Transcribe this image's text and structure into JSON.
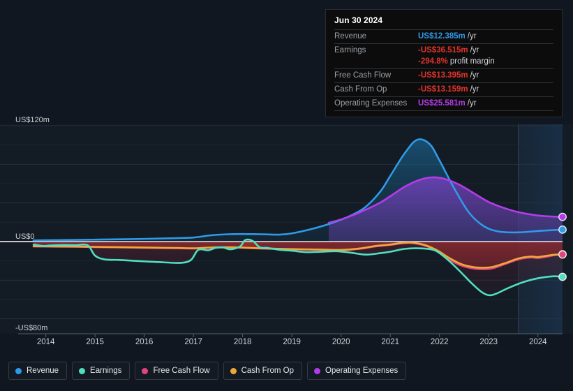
{
  "tooltip": {
    "date": "Jun 30 2024",
    "rows": [
      {
        "label": "Revenue",
        "value": "US$12.385m",
        "unit": "/yr",
        "color": "#2e9be8"
      },
      {
        "label": "Earnings",
        "value": "-US$36.515m",
        "unit": "/yr",
        "color": "#e2342c"
      },
      {
        "label": "",
        "value": "-294.8%",
        "unit": "profit margin",
        "color": "#e2342c",
        "sub": true
      },
      {
        "label": "Free Cash Flow",
        "value": "-US$13.395m",
        "unit": "/yr",
        "color": "#e2342c"
      },
      {
        "label": "Cash From Op",
        "value": "-US$13.159m",
        "unit": "/yr",
        "color": "#e2342c"
      },
      {
        "label": "Operating Expenses",
        "value": "US$25.581m",
        "unit": "/yr",
        "color": "#b43ce8"
      }
    ]
  },
  "legend": {
    "items": [
      {
        "label": "Revenue",
        "color": "#2e9be8"
      },
      {
        "label": "Earnings",
        "color": "#4fe0c0"
      },
      {
        "label": "Free Cash Flow",
        "color": "#e0457b"
      },
      {
        "label": "Cash From Op",
        "color": "#f0a73a"
      },
      {
        "label": "Operating Expenses",
        "color": "#b43ce8"
      }
    ]
  },
  "chart_data": {
    "type": "area",
    "title": "",
    "xlabel": "",
    "ylabel": "US$",
    "currency": "US$",
    "unit": "m",
    "ylim": [
      -80,
      120
    ],
    "yticks": [
      120,
      0,
      -80
    ],
    "ytick_labels": [
      "US$120m",
      "US$0",
      "-US$80m"
    ],
    "gridlines": [
      120,
      100,
      80,
      60,
      40,
      20,
      0,
      -20,
      -40,
      -60,
      -80
    ],
    "grid": true,
    "legend_position": "bottom-left",
    "x": [
      "2014",
      "2015",
      "2016",
      "2017",
      "2018",
      "2019",
      "2020",
      "2021",
      "2022",
      "2023",
      "2024"
    ],
    "xtick_labels": [
      "2014",
      "2015",
      "2016",
      "2017",
      "2018",
      "2019",
      "2020",
      "2021",
      "2022",
      "2023",
      "2024"
    ],
    "forecast_begins": "2023.6",
    "series": [
      {
        "name": "Revenue",
        "color": "#2e9be8",
        "points": [
          [
            2013.75,
            1.2
          ],
          [
            2014.0,
            1.4
          ],
          [
            2014.5,
            1.7
          ],
          [
            2015.0,
            2.0
          ],
          [
            2015.5,
            2.4
          ],
          [
            2016.0,
            2.8
          ],
          [
            2016.5,
            3.4
          ],
          [
            2017.0,
            4.2
          ],
          [
            2017.35,
            6.5
          ],
          [
            2017.7,
            7.6
          ],
          [
            2018.0,
            7.8
          ],
          [
            2018.4,
            7.6
          ],
          [
            2018.75,
            7.2
          ],
          [
            2019.0,
            8.5
          ],
          [
            2019.4,
            13.0
          ],
          [
            2019.8,
            19.0
          ],
          [
            2020.2,
            27.0
          ],
          [
            2020.5,
            36.0
          ],
          [
            2020.8,
            52.0
          ],
          [
            2021.0,
            68.0
          ],
          [
            2021.3,
            92.0
          ],
          [
            2021.55,
            105.5
          ],
          [
            2021.8,
            101.0
          ],
          [
            2022.0,
            84.0
          ],
          [
            2022.3,
            55.0
          ],
          [
            2022.6,
            30.0
          ],
          [
            2022.9,
            16.0
          ],
          [
            2023.2,
            10.5
          ],
          [
            2023.6,
            9.5
          ],
          [
            2024.0,
            11.0
          ],
          [
            2024.35,
            12.0
          ],
          [
            2024.5,
            12.385
          ]
        ]
      },
      {
        "name": "Operating Expenses",
        "color": "#b43ce8",
        "points": [
          [
            2019.75,
            19.5
          ],
          [
            2020.0,
            23.0
          ],
          [
            2020.25,
            27.5
          ],
          [
            2020.5,
            33.0
          ],
          [
            2020.8,
            40.5
          ],
          [
            2021.0,
            47.0
          ],
          [
            2021.3,
            57.0
          ],
          [
            2021.6,
            64.0
          ],
          [
            2021.85,
            66.5
          ],
          [
            2022.1,
            65.0
          ],
          [
            2022.4,
            59.0
          ],
          [
            2022.7,
            50.0
          ],
          [
            2023.0,
            41.0
          ],
          [
            2023.3,
            35.0
          ],
          [
            2023.6,
            30.5
          ],
          [
            2024.0,
            27.0
          ],
          [
            2024.35,
            25.8
          ],
          [
            2024.5,
            25.581
          ]
        ]
      },
      {
        "name": "Earnings",
        "color": "#4fe0c0",
        "points": [
          [
            2013.75,
            -3.0
          ],
          [
            2013.95,
            -4.5
          ],
          [
            2014.1,
            -4.0
          ],
          [
            2014.35,
            -3.6
          ],
          [
            2014.6,
            -3.7
          ],
          [
            2014.85,
            -3.8
          ],
          [
            2015.0,
            -14.5
          ],
          [
            2015.2,
            -18.5
          ],
          [
            2015.5,
            -19.0
          ],
          [
            2016.0,
            -20.5
          ],
          [
            2016.4,
            -21.5
          ],
          [
            2016.75,
            -22.0
          ],
          [
            2016.95,
            -19.0
          ],
          [
            2017.1,
            -8.5
          ],
          [
            2017.3,
            -9.0
          ],
          [
            2017.45,
            -6.5
          ],
          [
            2017.6,
            -6.0
          ],
          [
            2017.75,
            -8.0
          ],
          [
            2017.95,
            -5.0
          ],
          [
            2018.05,
            1.5
          ],
          [
            2018.2,
            0.8
          ],
          [
            2018.35,
            -6.0
          ],
          [
            2018.5,
            -6.5
          ],
          [
            2018.75,
            -8.5
          ],
          [
            2019.0,
            -9.5
          ],
          [
            2019.3,
            -11.0
          ],
          [
            2019.6,
            -10.5
          ],
          [
            2019.9,
            -10.0
          ],
          [
            2020.2,
            -11.5
          ],
          [
            2020.5,
            -13.5
          ],
          [
            2020.8,
            -12.0
          ],
          [
            2021.0,
            -10.5
          ],
          [
            2021.3,
            -7.5
          ],
          [
            2021.6,
            -7.0
          ],
          [
            2021.9,
            -9.0
          ],
          [
            2022.15,
            -18.0
          ],
          [
            2022.4,
            -30.0
          ],
          [
            2022.65,
            -43.0
          ],
          [
            2022.85,
            -52.0
          ],
          [
            2023.0,
            -55.5
          ],
          [
            2023.15,
            -54.0
          ],
          [
            2023.4,
            -48.0
          ],
          [
            2023.7,
            -42.0
          ],
          [
            2024.0,
            -38.0
          ],
          [
            2024.3,
            -36.0
          ],
          [
            2024.5,
            -36.515
          ]
        ]
      },
      {
        "name": "Cash From Op",
        "color": "#f0a73a",
        "points": [
          [
            2013.75,
            -4.8
          ],
          [
            2014.2,
            -5.0
          ],
          [
            2014.7,
            -5.2
          ],
          [
            2015.2,
            -5.6
          ],
          [
            2015.7,
            -5.9
          ],
          [
            2016.2,
            -6.3
          ],
          [
            2016.7,
            -6.6
          ],
          [
            2017.0,
            -6.9
          ],
          [
            2017.4,
            -6.0
          ],
          [
            2017.7,
            -5.8
          ],
          [
            2018.0,
            -6.2
          ],
          [
            2018.4,
            -7.0
          ],
          [
            2018.8,
            -7.5
          ],
          [
            2019.2,
            -8.0
          ],
          [
            2019.6,
            -8.3
          ],
          [
            2020.0,
            -8.6
          ],
          [
            2020.4,
            -7.0
          ],
          [
            2020.7,
            -4.5
          ],
          [
            2021.0,
            -3.0
          ],
          [
            2021.25,
            -1.2
          ],
          [
            2021.45,
            -1.0
          ],
          [
            2021.7,
            -3.5
          ],
          [
            2021.95,
            -9.0
          ],
          [
            2022.2,
            -17.0
          ],
          [
            2022.45,
            -23.5
          ],
          [
            2022.7,
            -26.5
          ],
          [
            2022.95,
            -27.0
          ],
          [
            2023.1,
            -26.0
          ],
          [
            2023.35,
            -22.0
          ],
          [
            2023.6,
            -17.5
          ],
          [
            2023.85,
            -15.5
          ],
          [
            2024.0,
            -16.0
          ],
          [
            2024.2,
            -14.5
          ],
          [
            2024.35,
            -13.5
          ],
          [
            2024.5,
            -13.159
          ]
        ]
      },
      {
        "name": "Free Cash Flow",
        "color": "#e0457b",
        "points": [
          [
            2013.75,
            -5.1
          ],
          [
            2014.2,
            -5.3
          ],
          [
            2014.7,
            -5.5
          ],
          [
            2015.2,
            -5.9
          ],
          [
            2015.7,
            -6.2
          ],
          [
            2016.2,
            -6.6
          ],
          [
            2016.7,
            -6.9
          ],
          [
            2017.0,
            -7.2
          ],
          [
            2017.4,
            -6.3
          ],
          [
            2017.7,
            -6.1
          ],
          [
            2018.0,
            -6.5
          ],
          [
            2018.4,
            -7.3
          ],
          [
            2018.8,
            -7.8
          ],
          [
            2019.2,
            -8.3
          ],
          [
            2019.6,
            -8.6
          ],
          [
            2020.0,
            -8.9
          ],
          [
            2020.4,
            -7.4
          ],
          [
            2020.7,
            -5.0
          ],
          [
            2021.0,
            -3.5
          ],
          [
            2021.25,
            -1.8
          ],
          [
            2021.45,
            -1.6
          ],
          [
            2021.7,
            -4.2
          ],
          [
            2021.95,
            -10.0
          ],
          [
            2022.2,
            -18.5
          ],
          [
            2022.45,
            -25.0
          ],
          [
            2022.7,
            -28.0
          ],
          [
            2022.95,
            -28.5
          ],
          [
            2023.1,
            -27.5
          ],
          [
            2023.35,
            -23.0
          ],
          [
            2023.6,
            -18.5
          ],
          [
            2023.85,
            -16.5
          ],
          [
            2024.0,
            -17.0
          ],
          [
            2024.2,
            -15.5
          ],
          [
            2024.35,
            -14.0
          ],
          [
            2024.5,
            -13.395
          ]
        ]
      }
    ]
  }
}
